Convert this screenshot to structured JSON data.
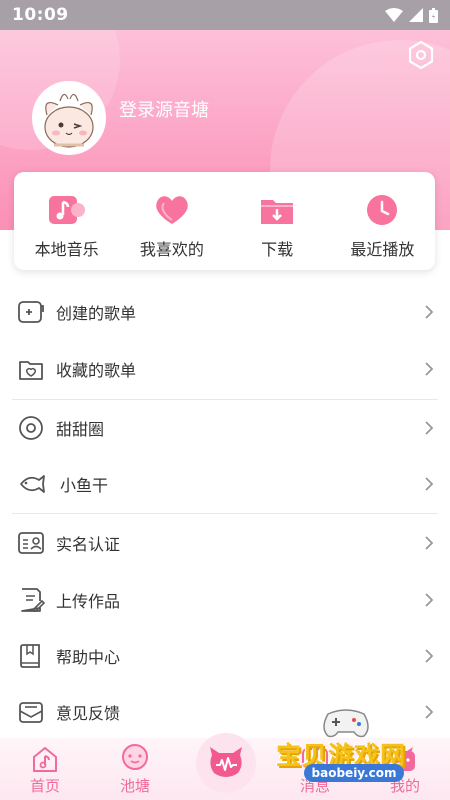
{
  "status_bar": {
    "time": "10:09"
  },
  "profile": {
    "login_text": "登录源音塘"
  },
  "quick_actions": [
    {
      "label": "本地音乐",
      "icon": "music-note-icon"
    },
    {
      "label": "我喜欢的",
      "icon": "heart-icon"
    },
    {
      "label": "下载",
      "icon": "download-folder-icon"
    },
    {
      "label": "最近播放",
      "icon": "clock-icon"
    }
  ],
  "menu": [
    {
      "label": "创建的歌单",
      "icon": "create-playlist-icon"
    },
    {
      "label": "收藏的歌单",
      "icon": "favorite-playlist-icon"
    },
    {
      "label": "甜甜圈",
      "icon": "donut-icon"
    },
    {
      "label": "小鱼干",
      "icon": "fish-icon"
    },
    {
      "label": "实名认证",
      "icon": "id-card-icon"
    },
    {
      "label": "上传作品",
      "icon": "upload-document-icon"
    },
    {
      "label": "帮助中心",
      "icon": "help-book-icon"
    },
    {
      "label": "意见反馈",
      "icon": "feedback-mail-icon"
    }
  ],
  "bottom_nav": [
    {
      "label": "首页",
      "icon": "home-music-icon"
    },
    {
      "label": "池塘",
      "icon": "pond-chat-icon"
    },
    {
      "label": "",
      "icon": "center-cat-icon"
    },
    {
      "label": "消息",
      "icon": "message-icon"
    },
    {
      "label": "我的",
      "icon": "profile-icon"
    }
  ],
  "watermark": {
    "title": "宝贝游戏网",
    "url": "baobeiy.com"
  },
  "colors": {
    "accent": "#f06b9a",
    "header_top": "#fdc0d8",
    "header_bottom": "#fb8fb6"
  }
}
